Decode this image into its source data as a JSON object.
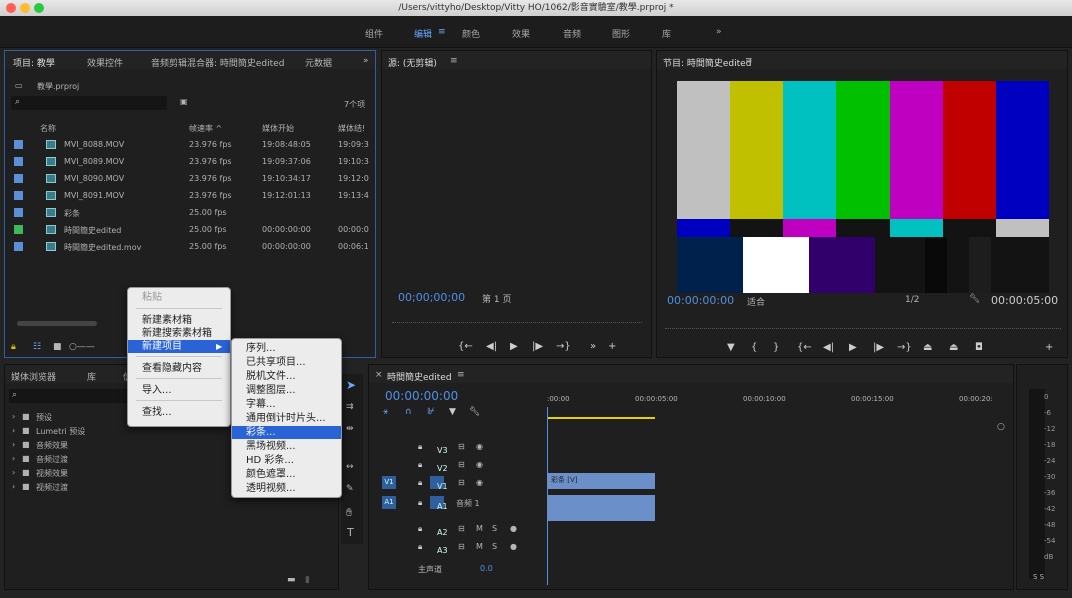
{
  "window_title": "/Users/vittyho/Desktop/Vitty HO/1062/影音實驗室/教學.prproj *",
  "workspaces": [
    "组件",
    "编辑",
    "颜色",
    "效果",
    "音频",
    "图形",
    "库",
    "»"
  ],
  "project_panel": {
    "tabs": [
      "项目: 教學",
      "效果控件",
      "音频剪辑混合器: 時間簡史edited",
      "元数据",
      "»"
    ],
    "file": "教學.prproj",
    "count": "7个项",
    "columns": [
      "名称",
      "帧速率 ^",
      "媒体开始",
      "媒体结!"
    ],
    "rows": [
      {
        "name": "MVI_8088.MOV",
        "fps": "23.976 fps",
        "start": "19:08:48:05",
        "end": "19:09:3",
        "color": "#5b8fd8"
      },
      {
        "name": "MVI_8089.MOV",
        "fps": "23.976 fps",
        "start": "19:09:37:06",
        "end": "19:10:3",
        "color": "#5b8fd8"
      },
      {
        "name": "MVI_8090.MOV",
        "fps": "23.976 fps",
        "start": "19:10:34:17",
        "end": "19:12:0",
        "color": "#5b8fd8"
      },
      {
        "name": "MVI_8091.MOV",
        "fps": "23.976 fps",
        "start": "19:12:01:13",
        "end": "19:13:4",
        "color": "#5b8fd8"
      },
      {
        "name": "彩条",
        "fps": "25.00 fps",
        "start": "",
        "end": "",
        "color": "#5b8fd8"
      },
      {
        "name": "時間簡史edited",
        "fps": "25.00 fps",
        "start": "00:00:00:00",
        "end": "00:00:0",
        "color": "#3cb85a"
      },
      {
        "name": "時間簡史edited.mov",
        "fps": "25.00 fps",
        "start": "00:00:00:00",
        "end": "00:06:1",
        "color": "#5b8fd8"
      }
    ]
  },
  "media_browser": {
    "tabs": [
      "媒体浏览器",
      "库",
      "信"
    ],
    "items": [
      "预设",
      "Lumetri 预设",
      "音频效果",
      "音频过渡",
      "视频效果",
      "视频过渡"
    ]
  },
  "context_menu": {
    "items": [
      "粘贴",
      "新建素材箱",
      "新建搜索素材箱",
      "新建项目",
      "查看隐藏内容",
      "导入...",
      "查找..."
    ]
  },
  "submenu": {
    "items": [
      "序列...",
      "已共享项目...",
      "脱机文件...",
      "调整图层...",
      "字幕...",
      "通用倒计时片头...",
      "彩条...",
      "黑场视频...",
      "HD 彩条...",
      "颜色遮罩...",
      "透明视频..."
    ]
  },
  "source_monitor": {
    "title": "源: (无剪辑)",
    "timecode": "00;00;00;00",
    "page": "第 1 页"
  },
  "program_monitor": {
    "title": "节目: 時間簡史edited",
    "timecode": "00:00:00:00",
    "fit": "适合",
    "ratio": "1/2",
    "duration": "00:00:05:00"
  },
  "timeline": {
    "title": "時間簡史edited",
    "timecode": "00:00:00:00",
    "ruler": [
      ":00:00",
      "00:00:05:00",
      "00:00:10:00",
      "00:00:15:00",
      "00:00:20:"
    ],
    "tracks": [
      "V3",
      "V2",
      "V1",
      "A1",
      "A2",
      "A3"
    ],
    "audio_label": "音频 1",
    "master": "主声道",
    "master_value": "0.0",
    "clip": "彩条 [V]"
  },
  "vu": [
    "0",
    "-6",
    "-12",
    "-18",
    "-24",
    "-30",
    "-36",
    "-42",
    "-48",
    "-54",
    "dB"
  ],
  "vu_solo": "S S",
  "bars_top": [
    "#c0c0c0",
    "#c0c000",
    "#00c0c0",
    "#00c000",
    "#c000c0",
    "#c00000",
    "#0000c0"
  ],
  "bars_mid": [
    "#0000c0",
    "#131313",
    "#c000c0",
    "#131313",
    "#00c0c0",
    "#131313",
    "#c0c0c0"
  ],
  "bars_bottom": [
    "#00214c",
    "#ffffff",
    "#32006a",
    "#131313",
    "#090909",
    "#131313",
    "#1d1d1d",
    "#131313"
  ]
}
